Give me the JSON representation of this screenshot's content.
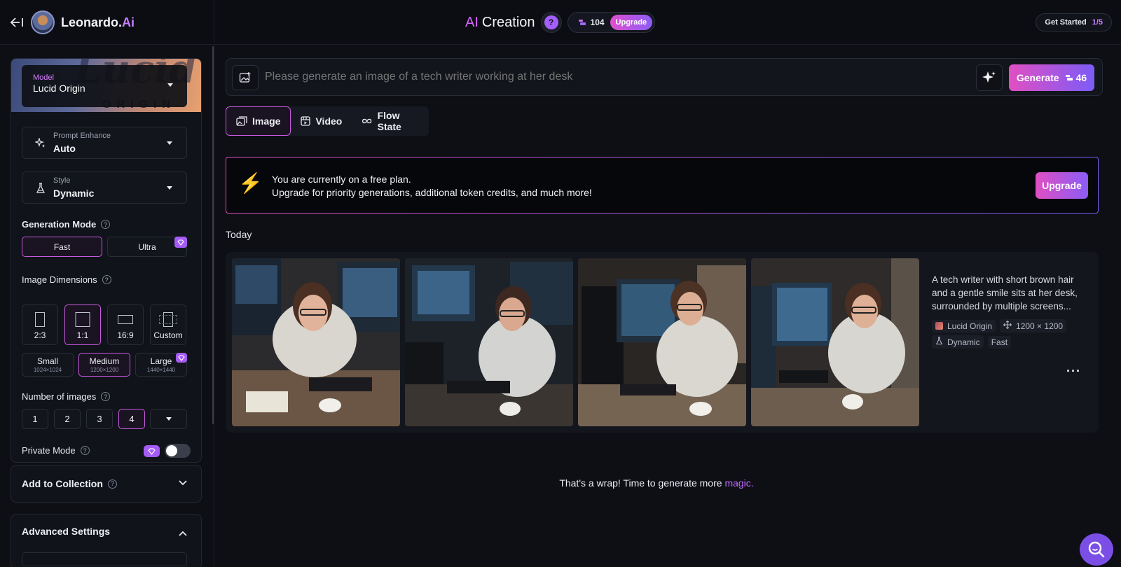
{
  "brand": {
    "name": "Leonardo.",
    "suffix": "Ai"
  },
  "header": {
    "title_ai": "AI",
    "title_rest": "Creation",
    "help": "?",
    "tokens": "104",
    "upgrade_label": "Upgrade",
    "get_started": "Get Started",
    "get_started_progress": "1/5"
  },
  "sidebar": {
    "model": {
      "label": "Model",
      "value": "Lucid Origin",
      "hero_script": "Lucid",
      "hero_origin": "ORIGIN"
    },
    "prompt_enhance": {
      "label": "Prompt Enhance",
      "value": "Auto"
    },
    "style": {
      "label": "Style",
      "value": "Dynamic"
    },
    "generation_mode": {
      "label": "Generation Mode",
      "options": [
        "Fast",
        "Ultra"
      ],
      "selected": "Fast"
    },
    "image_dimensions": {
      "label": "Image Dimensions",
      "ratios": [
        "2:3",
        "1:1",
        "16:9",
        "Custom"
      ],
      "selected_ratio": "1:1",
      "sizes": [
        {
          "name": "Small",
          "px": "1024×1024"
        },
        {
          "name": "Medium",
          "px": "1200×1200"
        },
        {
          "name": "Large",
          "px": "1440×1440"
        }
      ],
      "selected_size": "Medium"
    },
    "number_of_images": {
      "label": "Number of images",
      "options": [
        "1",
        "2",
        "3",
        "4"
      ],
      "selected": "4"
    },
    "private_mode": {
      "label": "Private Mode",
      "enabled": false
    },
    "add_to_collection": "Add to Collection",
    "advanced_settings": "Advanced Settings"
  },
  "main": {
    "prompt": {
      "placeholder": "Please generate an image of a tech writer working at her desk"
    },
    "generate": {
      "label": "Generate",
      "cost": "46"
    },
    "tabs": [
      {
        "label": "Image"
      },
      {
        "label": "Video"
      },
      {
        "label": "Flow State"
      }
    ],
    "active_tab": "Image",
    "banner": {
      "line1": "You are currently on a free plan.",
      "line2": "Upgrade for priority generations, additional token credits, and much more!",
      "button": "Upgrade"
    },
    "section_today": "Today",
    "generation": {
      "description": "A tech writer with short brown hair and a gentle smile sits at her desk, surrounded by multiple screens...",
      "model": "Lucid Origin",
      "dimensions": "1200 × 1200",
      "style": "Dynamic",
      "mode": "Fast",
      "more": "···"
    },
    "end_text": "That's a wrap! Time to generate more ",
    "end_link": "magic."
  },
  "colors": {
    "accent_pink": "#e04fc2",
    "accent_purple": "#7c5cf6",
    "brand_purple": "#c77dff"
  }
}
